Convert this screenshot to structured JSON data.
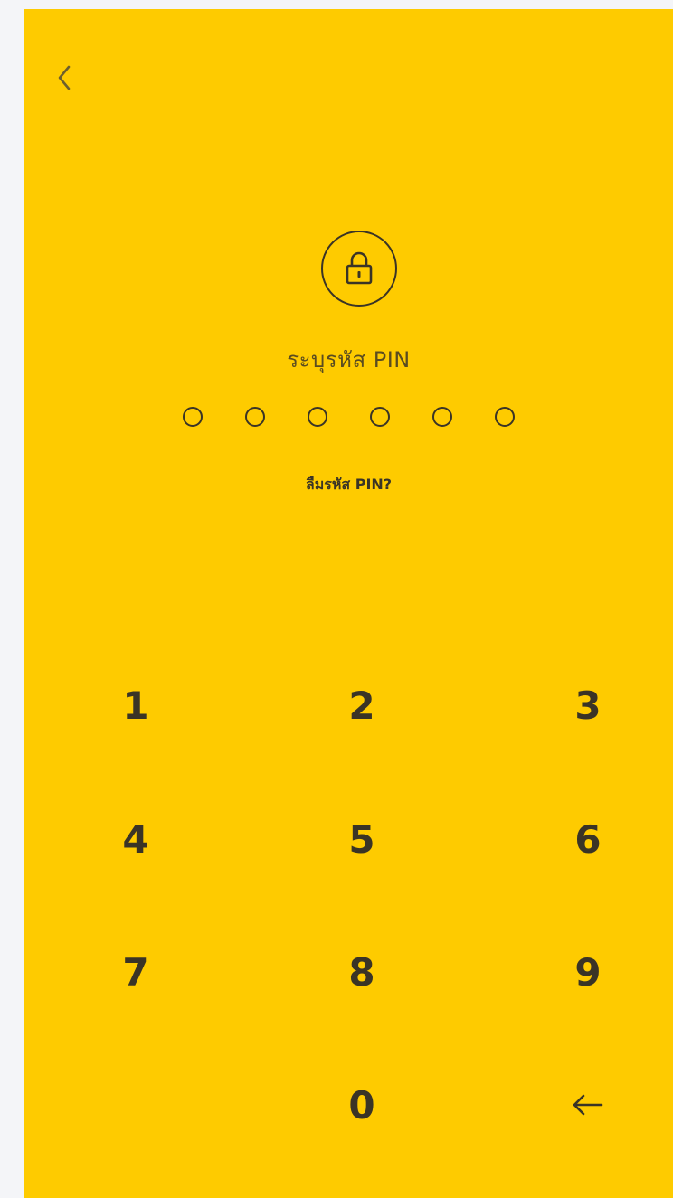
{
  "header": {
    "back_icon": "chevron-left-icon"
  },
  "lock": {
    "icon": "lock-icon"
  },
  "pin": {
    "prompt": "ระบุรหัส PIN",
    "length": 6,
    "entered": 0,
    "forgot_label": "ลืมรหัส PIN?"
  },
  "keypad": {
    "keys": [
      "1",
      "2",
      "3",
      "4",
      "5",
      "6",
      "7",
      "8",
      "9",
      "0"
    ],
    "backspace_icon": "backspace-arrow-icon"
  },
  "colors": {
    "background": "#fecb00",
    "foreground": "#3a3426"
  }
}
